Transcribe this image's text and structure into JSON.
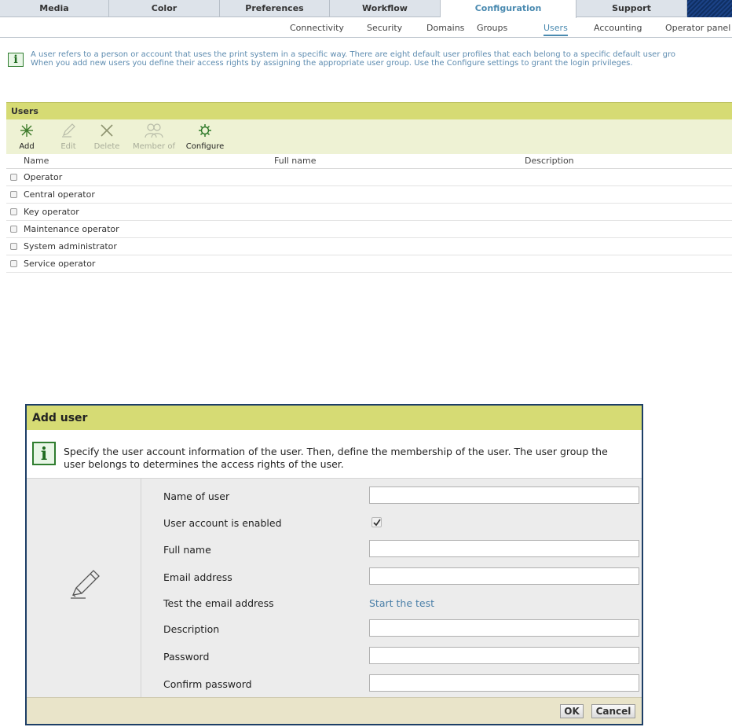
{
  "tabs": [
    {
      "label": "Media"
    },
    {
      "label": "Color"
    },
    {
      "label": "Preferences"
    },
    {
      "label": "Workflow"
    },
    {
      "label": "Configuration",
      "active": true
    },
    {
      "label": "Support"
    }
  ],
  "subnav": [
    {
      "label": "Connectivity"
    },
    {
      "label": "Security"
    },
    {
      "label": "Domains"
    },
    {
      "label": "Groups"
    },
    {
      "label": "Users",
      "active": true
    },
    {
      "label": "Accounting"
    },
    {
      "label": "Operator panel"
    }
  ],
  "info": {
    "line1": "A user refers to a person or account that uses the print system in a specific way. There are eight default user profiles that each belong to a specific default user gro",
    "line2": "When you add new users you define their access rights by assigning the appropriate user group. Use the Configure settings to grant the login privileges."
  },
  "users_panel": {
    "title": "Users",
    "toolbar": [
      {
        "label": "Add",
        "icon": "add-user-icon",
        "enabled": true
      },
      {
        "label": "Edit",
        "icon": "pencil-icon",
        "enabled": false
      },
      {
        "label": "Delete",
        "icon": "delete-x-icon",
        "enabled": false
      },
      {
        "label": "Member of",
        "icon": "group-members-icon",
        "enabled": false
      },
      {
        "label": "Configure",
        "icon": "gear-icon",
        "enabled": true
      }
    ],
    "columns": [
      "Name",
      "Full name",
      "Description"
    ],
    "rows": [
      {
        "name": "Operator"
      },
      {
        "name": "Central operator"
      },
      {
        "name": "Key operator"
      },
      {
        "name": "Maintenance operator"
      },
      {
        "name": "System administrator"
      },
      {
        "name": "Service operator"
      }
    ]
  },
  "dialog": {
    "title": "Add user",
    "info": "Specify the user account information of the user. Then, define the membership of the user. The user group the user belongs to determines the access rights of the user.",
    "fields": {
      "name_of_user": {
        "label": "Name of user",
        "value": ""
      },
      "account_enabled": {
        "label": "User account is enabled",
        "checked": true
      },
      "full_name": {
        "label": "Full name",
        "value": ""
      },
      "email": {
        "label": "Email address",
        "value": ""
      },
      "test_email": {
        "label": "Test the email address",
        "link": "Start the test"
      },
      "description": {
        "label": "Description",
        "value": ""
      },
      "password": {
        "label": "Password",
        "value": ""
      },
      "confirm_password": {
        "label": "Confirm password",
        "value": ""
      }
    },
    "ok_label": "OK",
    "cancel_label": "Cancel"
  },
  "colors": {
    "accent": "#4a8ab0",
    "panel_header": "#d6db74",
    "dialog_border": "#1d3e66"
  }
}
